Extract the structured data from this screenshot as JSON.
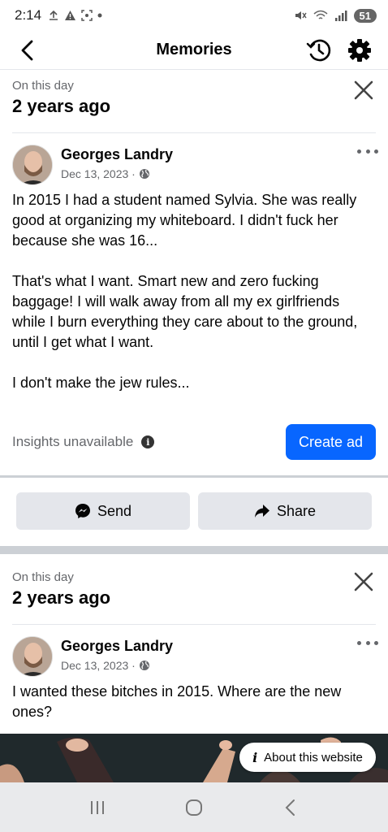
{
  "status_bar": {
    "time": "2:14",
    "battery": "51"
  },
  "header": {
    "title": "Memories"
  },
  "memories": [
    {
      "label": "On this day",
      "age": "2 years ago",
      "author": "Georges Landry",
      "date": "Dec 13, 2023 ·",
      "text": "In 2015 I had a student named Sylvia. She was really good at organizing my whiteboard. I didn't fuck her because she was 16...\n\nThat's what I want. Smart new and zero fucking baggage! I will walk away from all my ex girlfriends while I burn everything they care about to the ground, until I get what I want.\n\nI don't make the jew rules...",
      "insights": "Insights unavailable",
      "create_ad": "Create ad"
    },
    {
      "label": "On this day",
      "age": "2 years ago",
      "author": "Georges Landry",
      "date": "Dec 13, 2023 ·",
      "text": "I wanted these bitches in 2015. Where are the new ones?"
    }
  ],
  "actions": {
    "send": "Send",
    "share": "Share"
  },
  "about_website": "About this website",
  "colors": {
    "accent": "#0866ff",
    "secondary_text": "#65676b",
    "button_bg": "#e4e6eb"
  },
  "icons": [
    "back-arrow-icon",
    "history-icon",
    "gear-icon",
    "close-icon",
    "globe-icon",
    "more-icon",
    "info-icon",
    "messenger-icon",
    "share-arrow-icon",
    "info-i-icon"
  ]
}
